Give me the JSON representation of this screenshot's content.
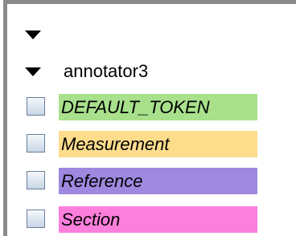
{
  "tree": {
    "root_expanded": true,
    "group": {
      "label": "annotator3",
      "expanded": true
    },
    "items": [
      {
        "label": "DEFAULT_TOKEN",
        "color": "#a8e08c",
        "checked": false
      },
      {
        "label": "Measurement",
        "color": "#fddc8c",
        "checked": false
      },
      {
        "label": "Reference",
        "color": "#9e88e0",
        "checked": false
      },
      {
        "label": "Section",
        "color": "#fc7fdc",
        "checked": false
      }
    ]
  }
}
